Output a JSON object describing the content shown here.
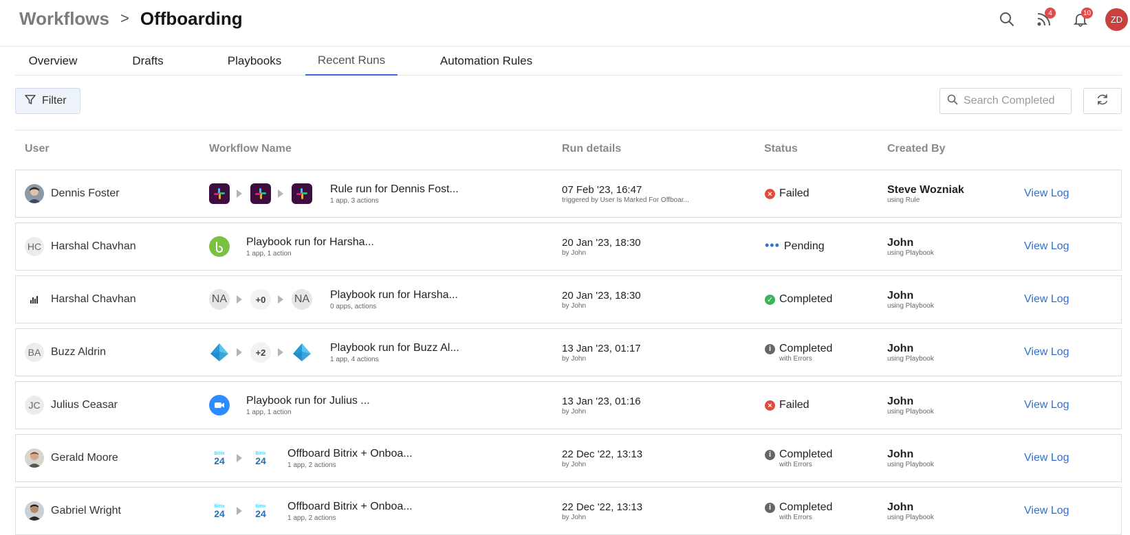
{
  "header": {
    "breadcrumb_parent": "Workflows",
    "breadcrumb_sep": ">",
    "breadcrumb_current": "Offboarding",
    "feed_badge": "4",
    "notifications_badge": "10",
    "user_initials": "ZD"
  },
  "tabs": [
    {
      "label": "Overview"
    },
    {
      "label": "Drafts"
    },
    {
      "label": "Playbooks"
    },
    {
      "label": "Recent Runs"
    },
    {
      "label": "Automation Rules"
    }
  ],
  "toolbar": {
    "filter_label": "Filter",
    "search_placeholder": "Search Completed"
  },
  "table": {
    "columns": [
      "User",
      "Workflow Name",
      "Run details",
      "Status",
      "Created By"
    ],
    "view_log_label": "View Log",
    "rows": [
      {
        "user": "Dennis Foster",
        "avatar": "photo",
        "workflow": "Rule run for Dennis Fost...",
        "workflow_sub": "1 app, 3 actions",
        "run": "07 Feb '23, 16:47",
        "run_sub": "triggered by User Is Marked For Offboar...",
        "status": "Failed",
        "status_sub": "",
        "status_kind": "failed",
        "created_by": "Steve Wozniak",
        "created_via": "using Rule"
      },
      {
        "user": "Harshal Chavhan",
        "avatar": "HC",
        "workflow": "Playbook run for Harsha...",
        "workflow_sub": "1 app, 1 action",
        "run": "20 Jan '23, 18:30",
        "run_sub": "by John",
        "status": "Pending",
        "status_sub": "",
        "status_kind": "pending",
        "created_by": "John",
        "created_via": "using Playbook"
      },
      {
        "user": "Harshal Chavhan",
        "avatar": "logo",
        "workflow": "Playbook run for Harsha...",
        "workflow_sub": "0 apps, actions",
        "run": "20 Jan '23, 18:30",
        "run_sub": "by John",
        "status": "Completed",
        "status_sub": "",
        "status_kind": "completed",
        "created_by": "John",
        "created_via": "using Playbook",
        "na_left": "NA",
        "pill": "+0",
        "na_right": "NA"
      },
      {
        "user": "Buzz Aldrin",
        "avatar": "BA",
        "workflow": "Playbook run for Buzz Al...",
        "workflow_sub": "1 app, 4 actions",
        "run": "13 Jan '23, 01:17",
        "run_sub": "by John",
        "status": "Completed",
        "status_sub": "with Errors",
        "status_kind": "errors",
        "created_by": "John",
        "created_via": "using Playbook",
        "pill": "+2"
      },
      {
        "user": "Julius Ceasar",
        "avatar": "JC",
        "workflow": "Playbook run for Julius ...",
        "workflow_sub": "1 app, 1 action",
        "run": "13 Jan '23, 01:16",
        "run_sub": "by John",
        "status": "Failed",
        "status_sub": "",
        "status_kind": "failed",
        "created_by": "John",
        "created_via": "using Playbook"
      },
      {
        "user": "Gerald Moore",
        "avatar": "photo",
        "workflow": "Offboard Bitrix + Onboa...",
        "workflow_sub": "1 app, 2 actions",
        "run": "22 Dec '22, 13:13",
        "run_sub": "by John",
        "status": "Completed",
        "status_sub": "with Errors",
        "status_kind": "errors",
        "created_by": "John",
        "created_via": "using Playbook"
      },
      {
        "user": "Gabriel Wright",
        "avatar": "photo",
        "workflow": "Offboard Bitrix + Onboa...",
        "workflow_sub": "1 app, 2 actions",
        "run": "22 Dec '22, 13:13",
        "run_sub": "by John",
        "status": "Completed",
        "status_sub": "with Errors",
        "status_kind": "errors",
        "created_by": "John",
        "created_via": "using Playbook"
      }
    ]
  },
  "app_icons": {
    "slack_label": "slack-icon",
    "bitrix_brand": "Bitrix",
    "bitrix_num": "24"
  },
  "colors": {
    "accent": "#2f6fd1",
    "failed": "#e24b3d",
    "completed": "#3cb55a",
    "pending": "#2f6fd1",
    "errors": "#666666"
  }
}
